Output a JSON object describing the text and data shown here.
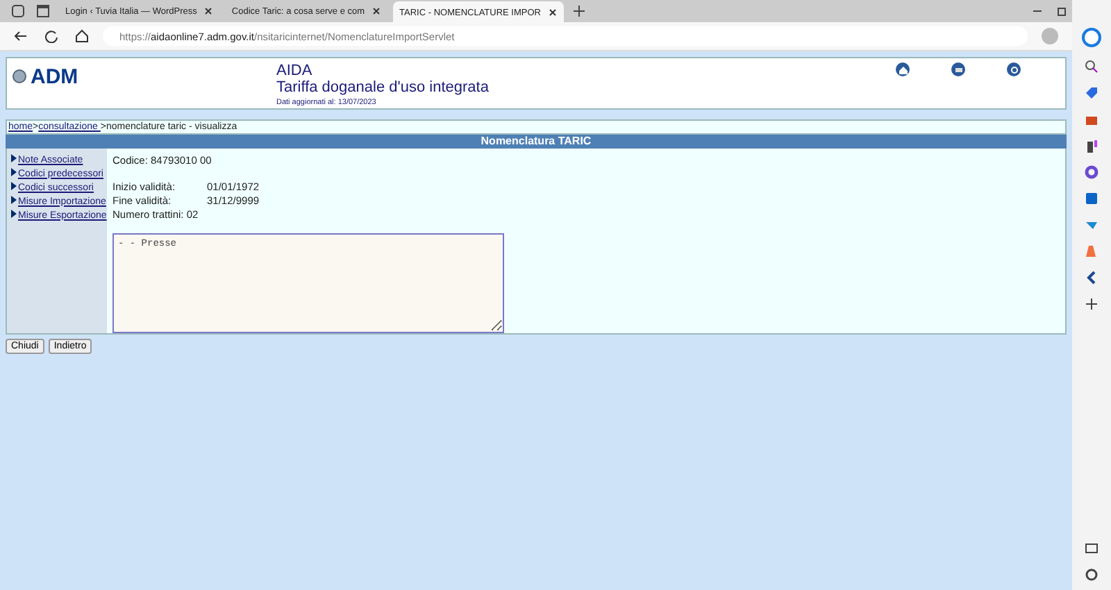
{
  "browser": {
    "tabs": [
      {
        "title": "Login ‹ Tuvia Italia — WordPress",
        "selected": false
      },
      {
        "title": "Codice Taric: a cosa serve e com",
        "selected": false
      },
      {
        "title": "TARIC - NOMENCLATURE IMPOR",
        "selected": true
      }
    ],
    "url": "https://**aidaonline7.adm.gov.it**/nsitaricinternet/NomenclatureImportServlet"
  },
  "header": {
    "logo": "ADM",
    "app_name": "AIDA",
    "subtitle": "Tariffa doganale d'uso integrata",
    "updated": "Dati aggiornati al: 13/07/2023"
  },
  "breadcrumb": [
    {
      "kind": "link",
      "text": "home"
    },
    {
      "kind": "text",
      "text": ">"
    },
    {
      "kind": "link",
      "text": "consultazione "
    },
    {
      "kind": "text",
      "text": ">nomenclature taric - visualizza"
    }
  ],
  "section_title": "Nomenclatura TARIC",
  "menu": [
    "Note Associate",
    "Codici predecessori",
    "Codici successori",
    "Misure Importazione",
    "Misure Esportazione"
  ],
  "code": "Codice: 84793010 00",
  "fields": [
    {
      "label": "Inizio validità:",
      "value": "01/01/1972"
    },
    {
      "label": "Fine validità:",
      "value": "31/12/9999"
    }
  ],
  "dashes": "Numero trattini: 02",
  "description": "- - Presse",
  "buttons": [
    "Chiudi",
    "Indietro"
  ]
}
